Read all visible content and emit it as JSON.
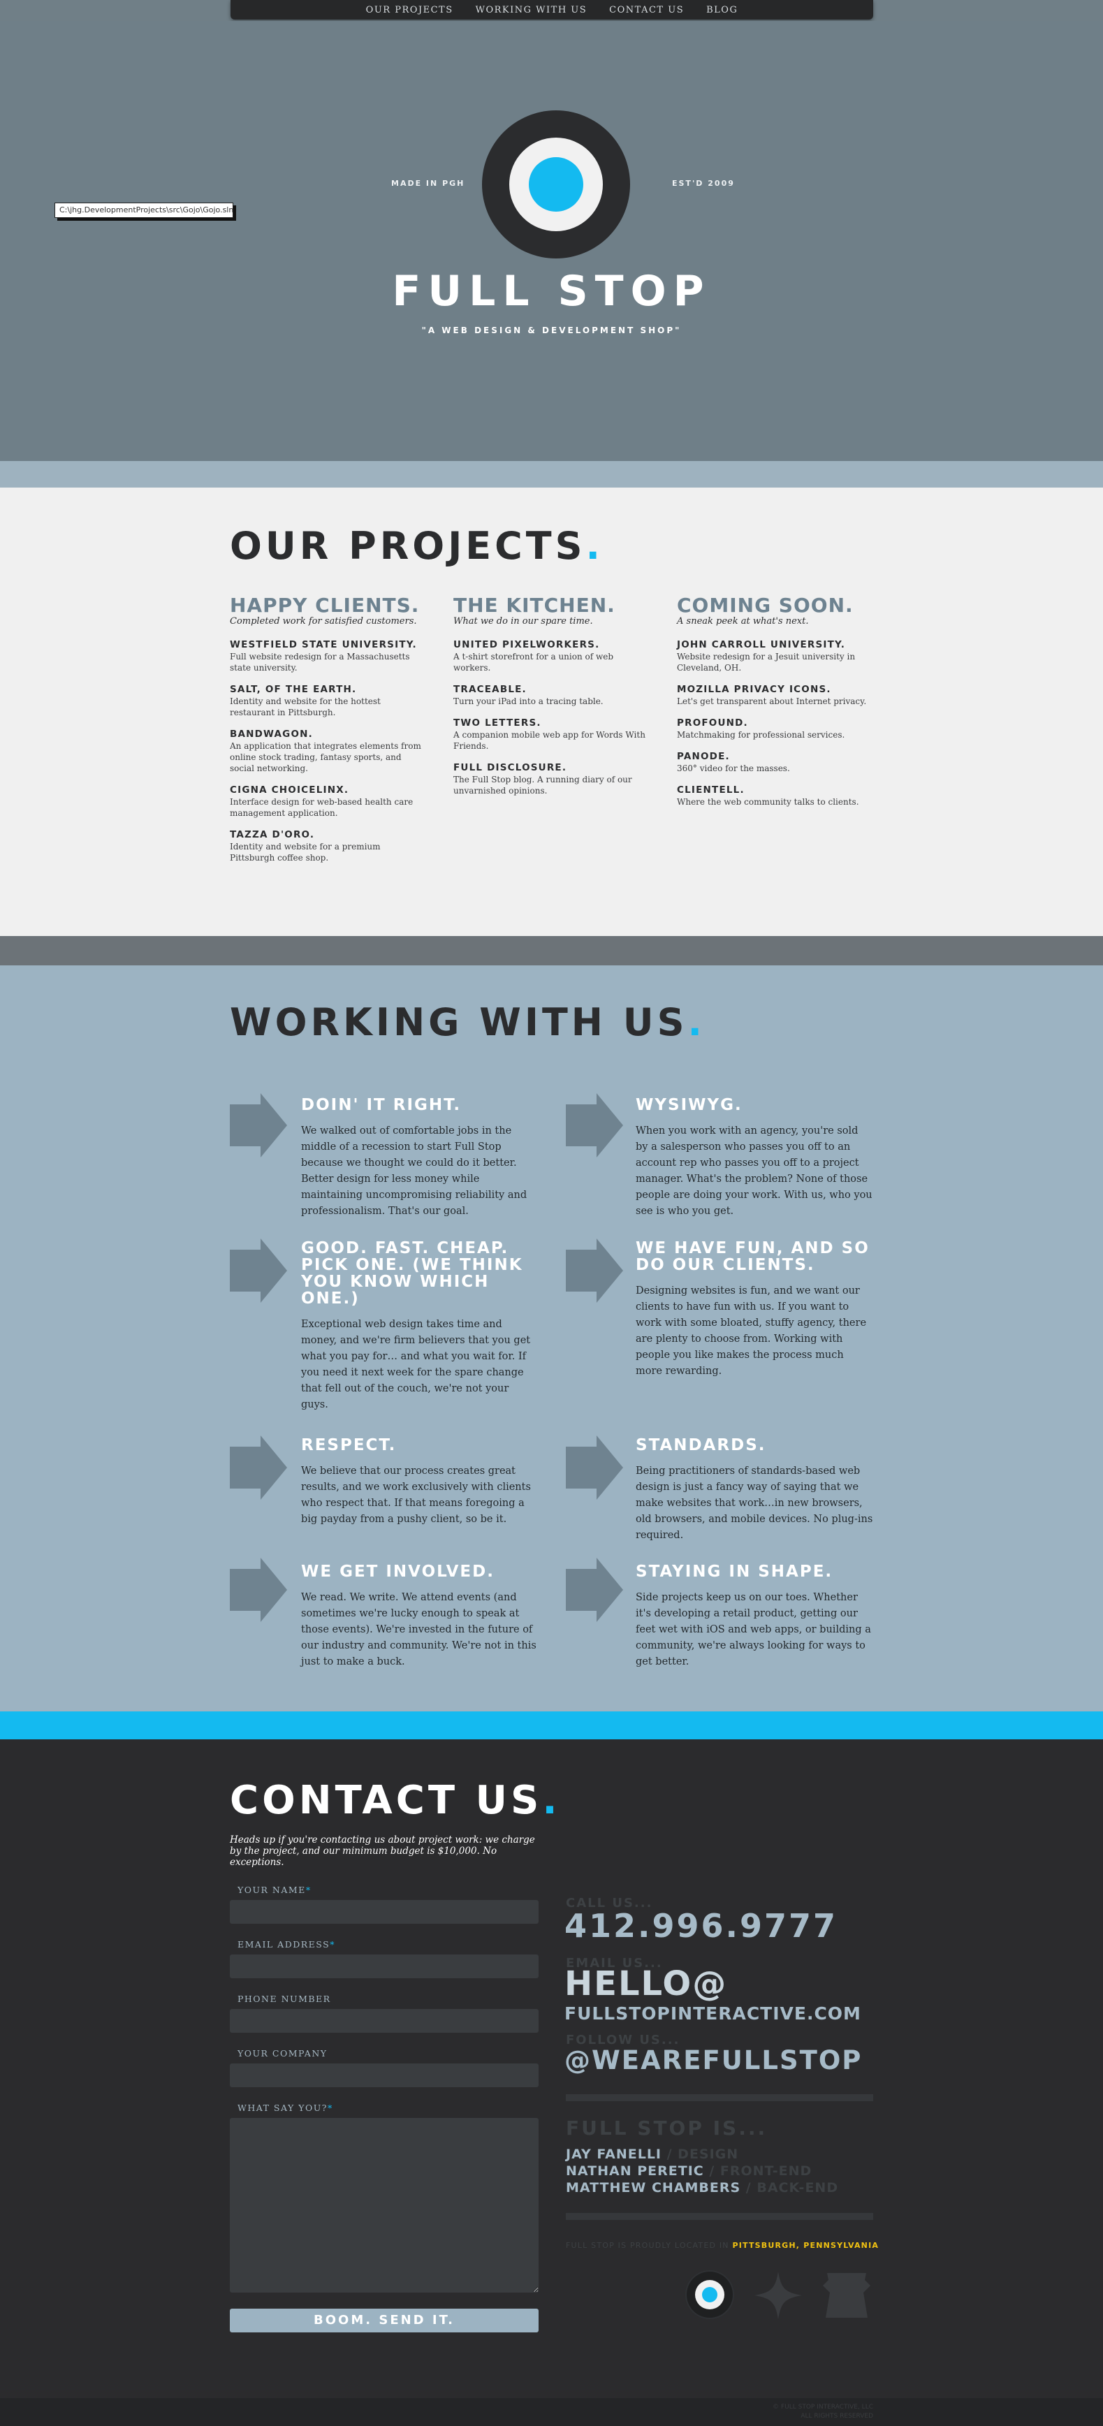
{
  "nav": {
    "items": [
      "OUR PROJECTS",
      "WORKING WITH US",
      "CONTACT US",
      "BLOG"
    ]
  },
  "hero": {
    "tooltip": "C:\\jhg.DevelopmentProjects\\src\\Gojo\\Gojo.sln",
    "left_text": "MADE IN PGH",
    "right_text": "EST'D 2009",
    "title": "FULL STOP",
    "tagline": "\"A WEB DESIGN & DEVELOPMENT SHOP\""
  },
  "projects": {
    "title": "OUR PROJECTS",
    "title_dot": ".",
    "columns": [
      {
        "heading": "HAPPY CLIENTS.",
        "subtitle": "Completed work for satisfied customers.",
        "items": [
          {
            "name": "WESTFIELD STATE UNIVERSITY.",
            "desc": "Full website redesign for a Massachusetts state university."
          },
          {
            "name": "SALT, OF THE EARTH.",
            "desc": "Identity and website for the hottest restaurant in Pittsburgh."
          },
          {
            "name": "BANDWAGON.",
            "desc": "An application that integrates elements from online stock trading, fantasy sports, and social networking."
          },
          {
            "name": "CIGNA CHOICELINX.",
            "desc": "Interface design for web-based health care management application."
          },
          {
            "name": "TAZZA D'ORO.",
            "desc": "Identity and website for a premium Pittsburgh coffee shop."
          }
        ]
      },
      {
        "heading": "THE KITCHEN.",
        "subtitle": "What we do in our spare time.",
        "items": [
          {
            "name": "UNITED PIXELWORKERS.",
            "desc": "A t-shirt storefront for a union of web workers."
          },
          {
            "name": "TRACEABLE.",
            "desc": "Turn your iPad into a tracing table."
          },
          {
            "name": "TWO LETTERS.",
            "desc": "A companion mobile web app for Words With Friends."
          },
          {
            "name": "FULL DISCLOSURE.",
            "desc": "The Full Stop blog. A running diary of our unvarnished opinions."
          }
        ]
      },
      {
        "heading": "COMING SOON.",
        "subtitle": "A sneak peek at what's next.",
        "items": [
          {
            "name": "JOHN CARROLL UNIVERSITY.",
            "desc": "Website redesign for a Jesuit university in Cleveland, OH."
          },
          {
            "name": "MOZILLA PRIVACY ICONS.",
            "desc": "Let's get transparent about Internet privacy."
          },
          {
            "name": "PROFOUND.",
            "desc": "Matchmaking for professional services."
          },
          {
            "name": "PANODE.",
            "desc": "360° video for the masses."
          },
          {
            "name": "CLIENTELL.",
            "desc": "Where the web community talks to clients."
          }
        ]
      }
    ]
  },
  "working": {
    "title": "WORKING WITH US",
    "title_dot": ".",
    "items": [
      {
        "heading": "DOIN' IT RIGHT.",
        "text": "We walked out of comfortable jobs in the middle of a recession to start Full Stop because we thought we could do it better. Better design for less money while maintaining uncompromising reliability and professionalism. That's our goal."
      },
      {
        "heading": "WYSIWYG.",
        "text": "When you work with an agency, you're sold by a salesperson who passes you off to an account rep who passes you off to a project manager. What's the problem? None of those people are doing your work. With us, who you see is who you get."
      },
      {
        "heading": "GOOD. FAST. CHEAP. PICK ONE. (WE THINK YOU KNOW WHICH ONE.)",
        "text": "Exceptional web design takes time and money, and we're firm believers that you get what you pay for… and what you wait for. If you need it next week for the spare change that fell out of the couch, we're not your guys."
      },
      {
        "heading": "WE HAVE FUN, AND SO DO OUR CLIENTS.",
        "text": "Designing websites is fun, and we want our clients to have fun with us. If you want to work with some bloated, stuffy agency, there are plenty to choose from. Working with people you like makes the process much more rewarding."
      },
      {
        "heading": "RESPECT.",
        "text": "We believe that our process creates great results, and we work exclusively with clients who respect that. If that means foregoing a big payday from a pushy client, so be it."
      },
      {
        "heading": "STANDARDS.",
        "text": "Being practitioners of standards-based web design is just a fancy way of saying that we make websites that work…in new browsers, old browsers, and mobile devices. No plug-ins required."
      },
      {
        "heading": "WE GET INVOLVED.",
        "text": "We read. We write. We attend events (and sometimes we're lucky enough to speak at those events). We're invested in the future of our industry and community. We're not in this just to make a buck."
      },
      {
        "heading": "STAYING IN SHAPE.",
        "text": "Side projects keep us on our toes. Whether it's developing a retail product, getting our feet wet with iOS and web apps, or building a community, we're always looking for ways to get better."
      }
    ]
  },
  "contact": {
    "title": "CONTACT US",
    "title_dot": ".",
    "note": "Heads up if you're contacting us about project work: we charge by the project, and our minimum budget is $10,000. No exceptions.",
    "fields": {
      "name_label": "YOUR NAME",
      "email_label": "EMAIL ADDRESS",
      "phone_label": "PHONE NUMBER",
      "company_label": "YOUR COMPANY",
      "message_label": "WHAT SAY YOU?",
      "required_mark": "*"
    },
    "submit_label": "BOOM. SEND IT.",
    "call_label": "CALL US...",
    "phone": "412.996.9777",
    "email_label": "EMAIL US...",
    "email_hello": "HELLO@",
    "email_domain": "FULLSTOPINTERACTIVE.COM",
    "follow_label": "FOLLOW US...",
    "twitter": "@WEAREFULLSTOP",
    "team_title": "FULL STOP IS...",
    "team": [
      {
        "name": "JAY FANELLI",
        "role": "DESIGN"
      },
      {
        "name": "NATHAN PERETIC",
        "role": "FRONT-END"
      },
      {
        "name": "MATTHEW CHAMBERS",
        "role": "BACK-END"
      }
    ],
    "located_text": "FULL STOP IS PROUDLY LOCATED IN",
    "city": "PITTSBURGH, PENNSYLVANIA"
  },
  "footer": {
    "line1": "© FULL STOP INTERACTIVE, LLC",
    "line2": "ALL RIGHTS RESERVED"
  },
  "colors": {
    "accent": "#14baf0",
    "hero_bg": "#6f7f88",
    "slate": "#9cb3c2",
    "dark": "#2b2b2d",
    "gold": "#f2c311"
  }
}
